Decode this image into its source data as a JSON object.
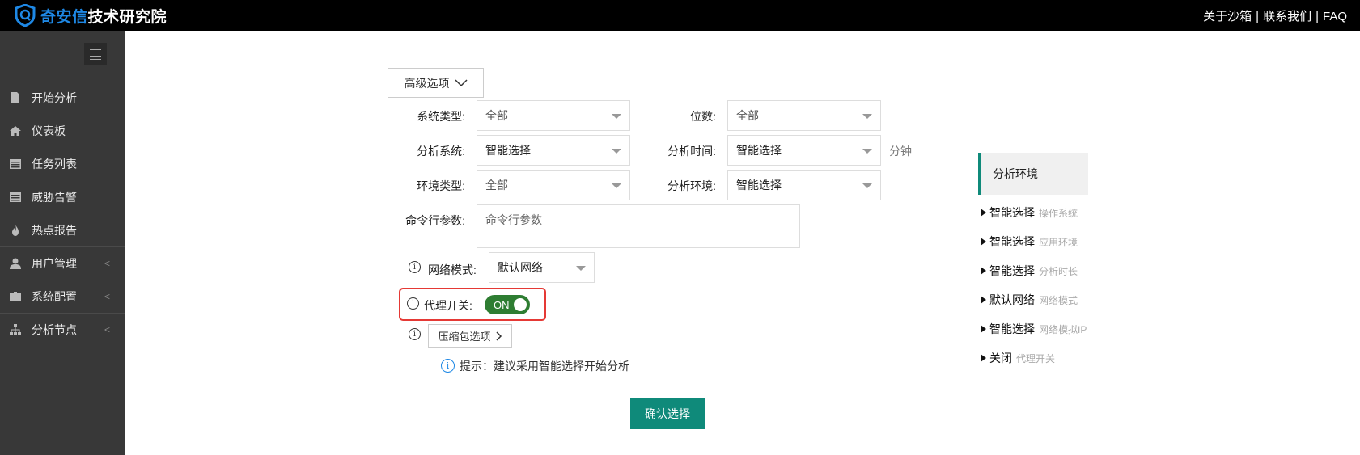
{
  "header": {
    "logo_brand": "奇安信",
    "logo_rest": "技术研究院",
    "links": [
      "关于沙箱",
      "联系我们",
      "FAQ"
    ],
    "separator": "|"
  },
  "sidebar": {
    "items": [
      {
        "label": "开始分析",
        "icon": "file-icon",
        "has_submenu": false
      },
      {
        "label": "仪表板",
        "icon": "home-icon",
        "has_submenu": false
      },
      {
        "label": "任务列表",
        "icon": "list-icon",
        "has_submenu": false
      },
      {
        "label": "威胁告警",
        "icon": "list-icon",
        "has_submenu": false
      },
      {
        "label": "热点报告",
        "icon": "fire-icon",
        "has_submenu": false
      },
      {
        "label": "用户管理",
        "icon": "user-icon",
        "has_submenu": true
      },
      {
        "label": "系统配置",
        "icon": "briefcase-icon",
        "has_submenu": true
      },
      {
        "label": "分析节点",
        "icon": "sitemap-icon",
        "has_submenu": true
      }
    ],
    "chevron": "<"
  },
  "form": {
    "advanced_label": "高级选项",
    "os_type_label": "系统类型:",
    "os_type_value": "全部",
    "bits_label": "位数:",
    "bits_value": "全部",
    "analysis_system_label": "分析系统:",
    "analysis_system_value": "智能选择",
    "analysis_time_label": "分析时间:",
    "analysis_time_value": "智能选择",
    "analysis_time_unit": "分钟",
    "env_type_label": "环境类型:",
    "env_type_value": "全部",
    "analysis_env_label": "分析环境:",
    "analysis_env_value": "智能选择",
    "cmdline_label": "命令行参数:",
    "cmdline_placeholder": "命令行参数",
    "network_mode_label": "网络模式:",
    "network_mode_value": "默认网络",
    "proxy_label": "代理开关:",
    "proxy_state": "ON",
    "zip_options_label": "压缩包选项",
    "tip_text": "提示：建议采用智能选择开始分析",
    "confirm_label": "确认选择",
    "info_glyph": "i"
  },
  "summary": {
    "title": "分析环境",
    "items": [
      {
        "value": "智能选择",
        "category": "操作系统"
      },
      {
        "value": "智能选择",
        "category": "应用环境"
      },
      {
        "value": "智能选择",
        "category": "分析时长"
      },
      {
        "value": "默认网络",
        "category": "网络模式"
      },
      {
        "value": "智能选择",
        "category": "网络模拟IP"
      },
      {
        "value": "关闭",
        "category": "代理开关"
      }
    ]
  },
  "colors": {
    "accent": "#0f8a7a",
    "toggle_on": "#2e7d32",
    "highlight": "#e53935",
    "brand_blue": "#1e88e5"
  }
}
